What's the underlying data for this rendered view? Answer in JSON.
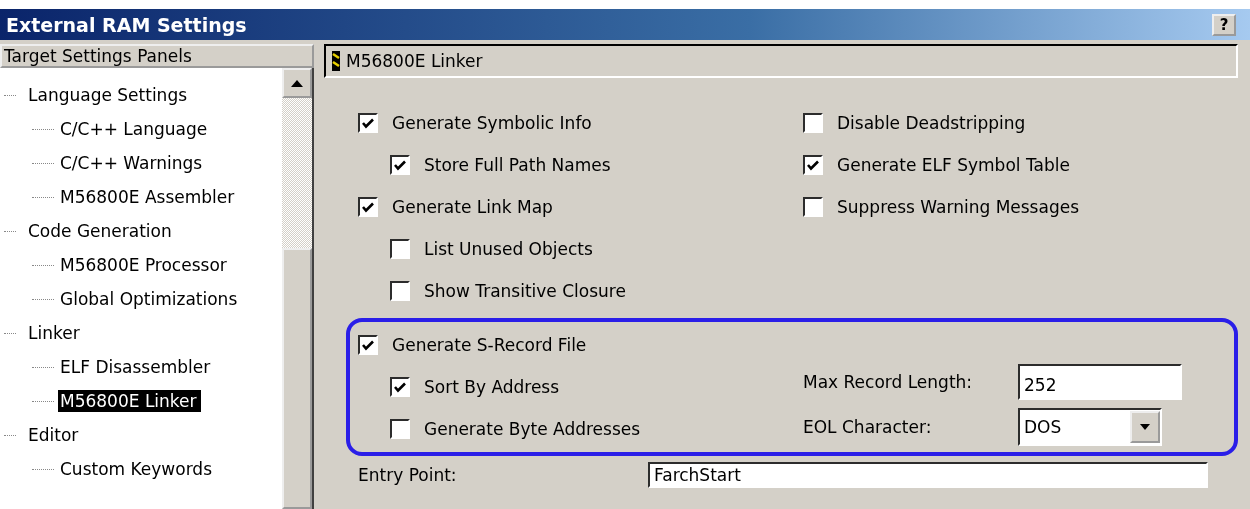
{
  "window": {
    "title": "External RAM Settings",
    "help_button": "?"
  },
  "panels_list": {
    "header": "Target Settings Panels",
    "items": [
      {
        "label": "Language Settings",
        "selected": false,
        "children": [
          {
            "label": "C/C++ Language",
            "selected": false
          },
          {
            "label": "C/C++ Warnings",
            "selected": false
          },
          {
            "label": "M56800E Assembler",
            "selected": false
          }
        ]
      },
      {
        "label": "Code Generation",
        "selected": false,
        "children": [
          {
            "label": "M56800E Processor",
            "selected": false
          },
          {
            "label": "Global Optimizations",
            "selected": false
          }
        ]
      },
      {
        "label": "Linker",
        "selected": false,
        "children": [
          {
            "label": "ELF Disassembler",
            "selected": false
          },
          {
            "label": "M56800E Linker",
            "selected": true
          }
        ]
      },
      {
        "label": "Editor",
        "selected": false,
        "children": [
          {
            "label": "Custom Keywords",
            "selected": false
          }
        ]
      }
    ]
  },
  "settings_panel": {
    "title": "M56800E Linker",
    "left_options": [
      {
        "label": "Generate Symbolic Info",
        "checked": true,
        "children": [
          {
            "label": "Store Full Path Names",
            "checked": true
          }
        ]
      },
      {
        "label": "Generate Link Map",
        "checked": true,
        "children": [
          {
            "label": "List Unused Objects",
            "checked": false
          },
          {
            "label": "Show Transitive Closure",
            "checked": false
          }
        ]
      }
    ],
    "right_options": [
      {
        "label": "Disable Deadstripping",
        "checked": false
      },
      {
        "label": "Generate ELF Symbol Table",
        "checked": true
      },
      {
        "label": "Suppress Warning Messages",
        "checked": false
      }
    ],
    "s_record_group": {
      "option": {
        "label": "Generate S-Record File",
        "checked": true,
        "children": [
          {
            "label": "Sort By Address",
            "checked": true
          },
          {
            "label": "Generate Byte Addresses",
            "checked": false
          }
        ]
      },
      "fields": [
        {
          "kind": "text",
          "label": "Max Record Length:",
          "value": "252"
        },
        {
          "kind": "dropdown",
          "label": "EOL Character:",
          "value": "DOS"
        }
      ]
    },
    "entry_point": {
      "label": "Entry Point:",
      "value": "FarchStart"
    }
  }
}
